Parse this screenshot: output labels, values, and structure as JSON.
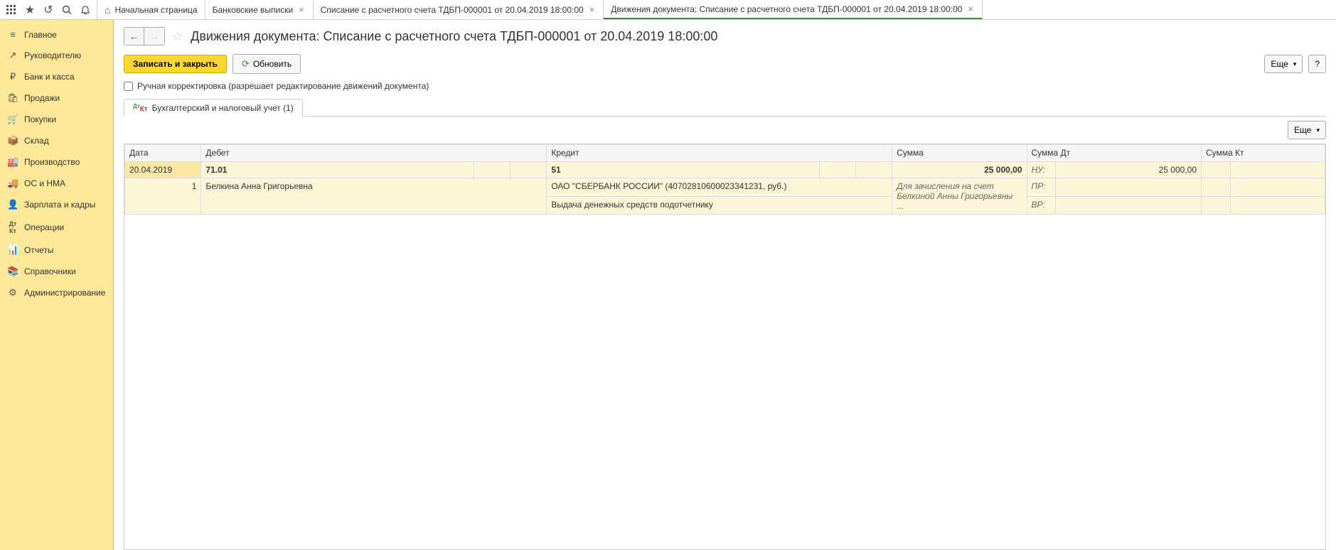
{
  "toolbar_icons": [
    "apps",
    "star",
    "history",
    "search",
    "bell"
  ],
  "tabs": [
    {
      "label": "Начальная страница",
      "closable": false,
      "home": true
    },
    {
      "label": "Банковские выписки",
      "closable": true
    },
    {
      "label": "Списание с расчетного счета ТДБП-000001 от 20.04.2019 18:00:00",
      "closable": true
    },
    {
      "label": "Движения документа: Списание с расчетного счета ТДБП-000001 от 20.04.2019 18:00:00",
      "closable": true,
      "active": true
    }
  ],
  "sidebar": [
    {
      "icon": "≡",
      "label": "Главное"
    },
    {
      "icon": "📈",
      "label": "Руководителю"
    },
    {
      "icon": "₽",
      "label": "Банк и касса"
    },
    {
      "icon": "🛍",
      "label": "Продажи"
    },
    {
      "icon": "🛒",
      "label": "Покупки"
    },
    {
      "icon": "📦",
      "label": "Склад"
    },
    {
      "icon": "🏭",
      "label": "Производство"
    },
    {
      "icon": "🚚",
      "label": "ОС и НМА"
    },
    {
      "icon": "👤",
      "label": "Зарплата и кадры"
    },
    {
      "icon": "ᴬᵀ",
      "label": "Операции"
    },
    {
      "icon": "📊",
      "label": "Отчеты"
    },
    {
      "icon": "📚",
      "label": "Справочники"
    },
    {
      "icon": "⚙",
      "label": "Администрирование"
    }
  ],
  "page": {
    "title": "Движения документа: Списание с расчетного счета ТДБП-000001 от 20.04.2019 18:00:00",
    "save_close": "Записать и закрыть",
    "refresh": "Обновить",
    "more": "Еще",
    "manual_label": "Ручная корректировка (разрешает редактирование движений документа)",
    "result_tab": "Бухгалтерский и налоговый учет (1)"
  },
  "table": {
    "headers": {
      "date": "Дата",
      "debit": "Дебет",
      "credit": "Кредит",
      "sum": "Сумма",
      "sum_dt": "Сумма Дт",
      "sum_kt": "Сумма Кт"
    },
    "row1": {
      "date": "20.04.2019",
      "debit_acc": "71.01",
      "credit_acc": "51",
      "sum": "25 000,00",
      "nu_label": "НУ:",
      "nu_dt": "25 000,00"
    },
    "row2": {
      "num": "1",
      "debit_sub": "Белкина Анна Григорьевна",
      "credit_sub": "ОАО \"СБЕРБАНК РОССИИ\" (40702810600023341231, руб.)",
      "credit_sub2": "Выдача денежных средств подотчетнику",
      "sum_desc": "Для зачисления на счет Белкиной Анны Григорьевны ...",
      "pr_label": "ПР:",
      "vr_label": "ВР:"
    }
  }
}
